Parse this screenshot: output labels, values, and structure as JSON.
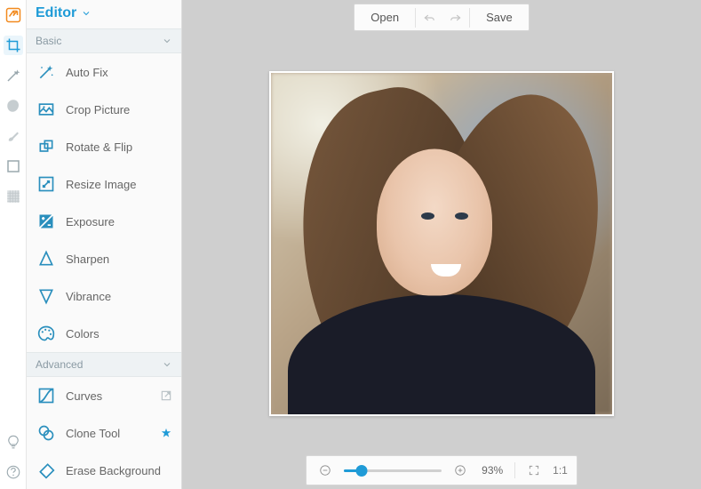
{
  "colors": {
    "accent": "#1f9bd7"
  },
  "iconbar": {
    "items": [
      {
        "name": "logo-icon"
      },
      {
        "name": "crop-icon"
      },
      {
        "name": "wand-icon"
      },
      {
        "name": "blob-icon"
      },
      {
        "name": "brush-icon"
      },
      {
        "name": "frame-icon"
      },
      {
        "name": "texture-icon"
      }
    ],
    "bottom": [
      {
        "name": "bulb-icon"
      },
      {
        "name": "help-icon"
      }
    ],
    "active_index": 1
  },
  "panel": {
    "header": "Editor",
    "sections": [
      {
        "title": "Basic",
        "items": [
          {
            "label": "Auto Fix",
            "icon": "wand-icon"
          },
          {
            "label": "Crop Picture",
            "icon": "crop-picture-icon"
          },
          {
            "label": "Rotate & Flip",
            "icon": "rotate-icon"
          },
          {
            "label": "Resize Image",
            "icon": "resize-icon"
          },
          {
            "label": "Exposure",
            "icon": "exposure-icon"
          },
          {
            "label": "Sharpen",
            "icon": "sharpen-icon"
          },
          {
            "label": "Vibrance",
            "icon": "vibrance-icon"
          },
          {
            "label": "Colors",
            "icon": "palette-icon"
          }
        ]
      },
      {
        "title": "Advanced",
        "items": [
          {
            "label": "Curves",
            "icon": "curves-icon",
            "badge": "popout-icon"
          },
          {
            "label": "Clone Tool",
            "icon": "clone-icon",
            "badge": "star-icon"
          },
          {
            "label": "Erase Background",
            "icon": "eraser-icon"
          }
        ]
      }
    ]
  },
  "topbar": {
    "open": "Open",
    "save": "Save"
  },
  "bottombar": {
    "zoom_percent": 93,
    "zoom_label": "93%",
    "one_to_one": "1:1"
  }
}
